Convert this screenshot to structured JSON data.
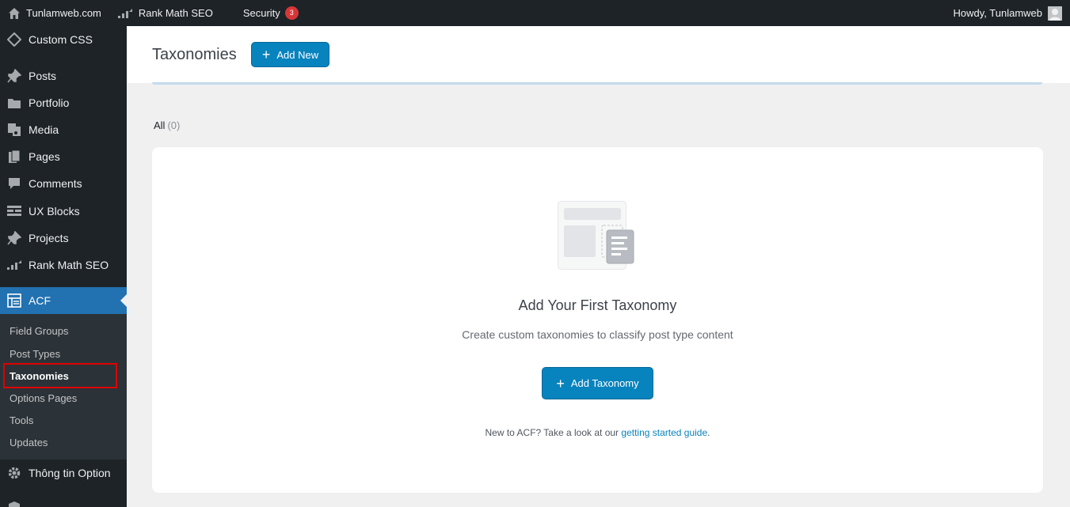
{
  "adminbar": {
    "site_name": "Tunlamweb.com",
    "rank_math": "Rank Math SEO",
    "security": "Security",
    "security_count": "3",
    "greeting": "Howdy, Tunlamweb"
  },
  "sidebar": {
    "items": [
      {
        "label": "Custom CSS",
        "icon": "diamond-icon"
      },
      {
        "label": "Posts",
        "icon": "pin-icon"
      },
      {
        "label": "Portfolio",
        "icon": "folder-icon"
      },
      {
        "label": "Media",
        "icon": "media-icon"
      },
      {
        "label": "Pages",
        "icon": "pages-icon"
      },
      {
        "label": "Comments",
        "icon": "comment-icon"
      },
      {
        "label": "UX Blocks",
        "icon": "blocks-icon"
      },
      {
        "label": "Projects",
        "icon": "pin-icon"
      },
      {
        "label": "Rank Math SEO",
        "icon": "rankmath-icon"
      },
      {
        "label": "ACF",
        "icon": "acf-icon"
      },
      {
        "label": "Thông tin Option",
        "icon": "gear-icon"
      }
    ],
    "submenu": [
      "Field Groups",
      "Post Types",
      "Taxonomies",
      "Options Pages",
      "Tools",
      "Updates"
    ]
  },
  "header": {
    "title": "Taxonomies",
    "add_new": "Add New"
  },
  "filter": {
    "all_label": "All",
    "all_count": "(0)"
  },
  "empty_state": {
    "title": "Add Your First Taxonomy",
    "description": "Create custom taxonomies to classify post type content",
    "button": "Add Taxonomy",
    "guide_prefix": "New to ACF? Take a look at our",
    "guide_link": "getting started guide",
    "guide_suffix": "."
  },
  "colors": {
    "accent": "#2271b1",
    "button": "#0783be",
    "highlight": "#e00000",
    "sidebar_bg": "#1d2327"
  }
}
